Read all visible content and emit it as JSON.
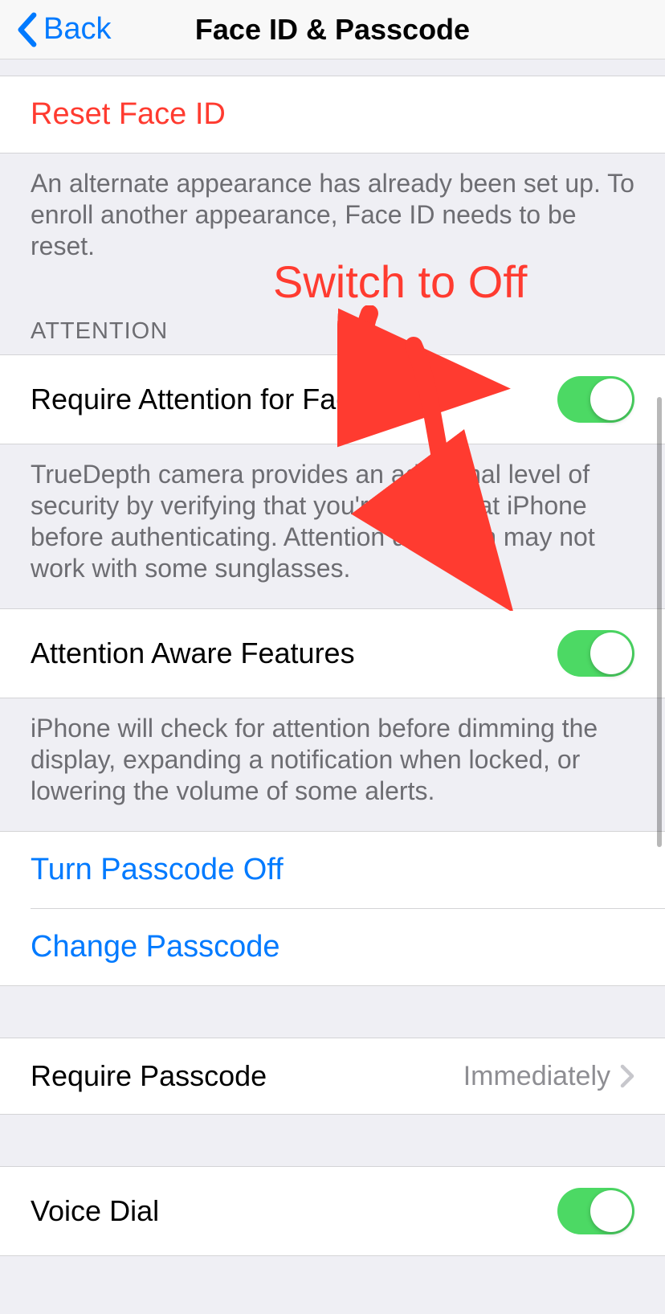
{
  "header": {
    "back_label": "Back",
    "title": "Face ID & Passcode"
  },
  "reset": {
    "label": "Reset Face ID",
    "footer": "An alternate appearance has already been set up. To enroll another appearance, Face ID needs to be reset."
  },
  "attention": {
    "section_header": "ATTENTION",
    "require_label": "Require Attention for Face ID",
    "require_on": true,
    "require_footer": "TrueDepth camera provides an additional level of security by verifying that you're looking at iPhone before authenticating. Attention detection may not work with some sunglasses.",
    "aware_label": "Attention Aware Features",
    "aware_on": true,
    "aware_footer": "iPhone will check for attention before dimming the display, expanding a notification when locked, or lowering the volume of some alerts."
  },
  "passcode": {
    "turn_off_label": "Turn Passcode Off",
    "change_label": "Change Passcode",
    "require_label": "Require Passcode",
    "require_value": "Immediately"
  },
  "voice_dial": {
    "label": "Voice Dial",
    "on": true
  },
  "annotation": {
    "text": "Switch to Off"
  },
  "colors": {
    "accent": "#007aff",
    "danger": "#ff3b30",
    "toggle_on": "#4cd964"
  }
}
